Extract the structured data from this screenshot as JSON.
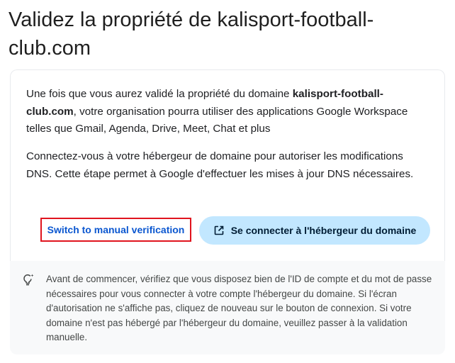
{
  "page": {
    "title": "Validez la propriété de kalisport-football-club.com"
  },
  "intro": {
    "text_before": "Une fois que vous aurez validé la propriété du domaine ",
    "domain": "kalisport-football-club.com",
    "text_after": ", votre organisation pourra utiliser des applications Google Workspace telles que Gmail, Agenda, Drive, Meet, Chat et plus"
  },
  "instructions": {
    "text": "Connectez-vous à votre hébergeur de domaine pour autoriser les modifications DNS. Cette étape permet à Google d'effectuer les mises à jour DNS nécessaires."
  },
  "actions": {
    "manual_label": "Switch to manual verification",
    "host_label": "Se connecter à l'hébergeur du domaine",
    "host_icon": "open-in-new-icon"
  },
  "tip": {
    "icon": "lightbulb-icon",
    "text": "Avant de commencer, vérifiez que vous disposez bien de l'ID de compte et du mot de passe nécessaires pour vous connecter à votre compte l'hébergeur du domaine. Si l'écran d'autorisation ne s'affiche pas, cliquez de nouveau sur le bouton de connexion. Si votre domaine n'est pas hébergé par l'hébergeur du domaine, veuillez passer à la validation manuelle."
  },
  "colors": {
    "accent": "#0b57d0",
    "primary_button_bg": "#c2e7ff",
    "highlight_border": "#e0141e",
    "card_bg": "#f8f9fa"
  }
}
